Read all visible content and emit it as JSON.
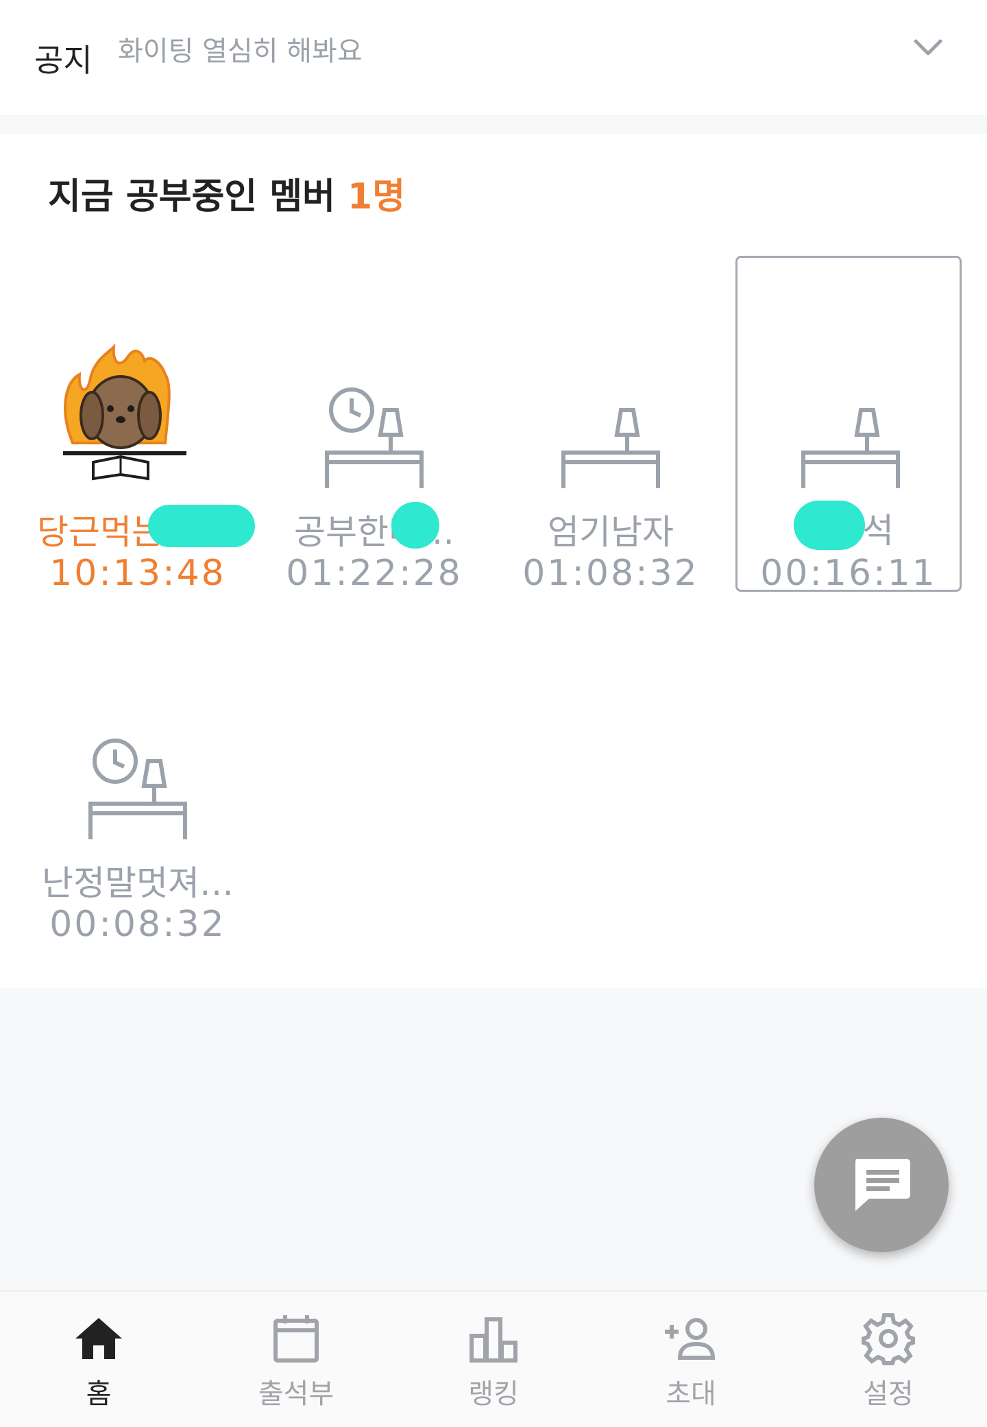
{
  "notice": {
    "label": "공지",
    "text": "화이팅 열심히 해봐요"
  },
  "section": {
    "title": "지금 공부중인 멤버",
    "count": "1명"
  },
  "members": [
    {
      "name": "당근먹는",
      "time": "10:13:48",
      "state": "studying"
    },
    {
      "name": "공부한다…",
      "time": "01:22:28",
      "state": "away"
    },
    {
      "name": "엄기남자",
      "time": "01:08:32",
      "state": "idle"
    },
    {
      "name": "석",
      "time": "00:16:11",
      "state": "idle",
      "selected": true
    },
    {
      "name": "난정말멋져…",
      "time": "00:08:32",
      "state": "away"
    }
  ],
  "tabs": [
    {
      "label": "홈",
      "icon": "home-icon",
      "active": true
    },
    {
      "label": "출석부",
      "icon": "calendar-icon"
    },
    {
      "label": "랭킹",
      "icon": "ranking-icon"
    },
    {
      "label": "초대",
      "icon": "add-person-icon"
    },
    {
      "label": "설정",
      "icon": "gear-icon"
    }
  ],
  "fab": {
    "icon": "chat-icon"
  },
  "colors": {
    "accent": "#f07f31",
    "muted": "#9ba2ab",
    "redaction": "#2ee8cf"
  }
}
